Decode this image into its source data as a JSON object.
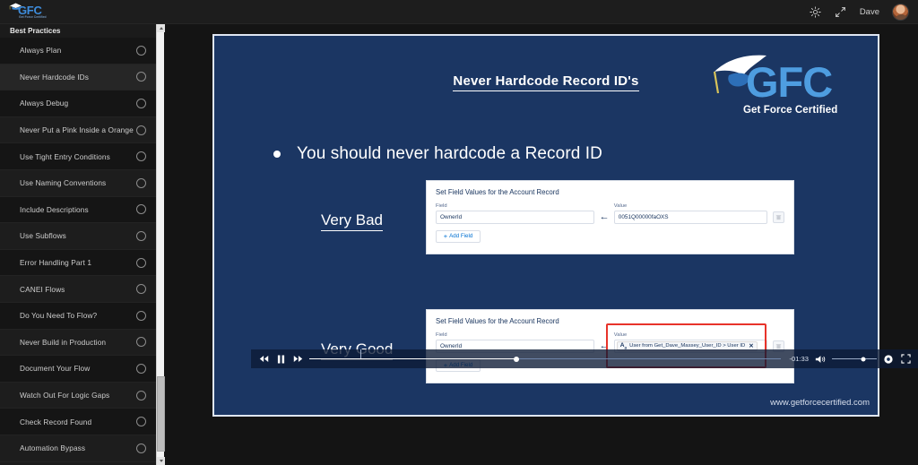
{
  "topbar": {
    "logo_main": "GFC",
    "logo_sub": "Get Force Certified",
    "theme_icon": "sun-icon",
    "expand_icon": "expand-arrows-icon",
    "user_name": "Dave",
    "avatar_icon": "user-avatar"
  },
  "sidebar": {
    "title": "Best Practices",
    "items": [
      {
        "label": "Always Plan",
        "completed": false
      },
      {
        "label": "Never Hardcode IDs",
        "completed": false,
        "active": true
      },
      {
        "label": "Always Debug",
        "completed": false
      },
      {
        "label": "Never Put a Pink Inside a Orange",
        "completed": false
      },
      {
        "label": "Use Tight Entry Conditions",
        "completed": false
      },
      {
        "label": "Use Naming Conventions",
        "completed": false
      },
      {
        "label": "Include Descriptions",
        "completed": false
      },
      {
        "label": "Use Subflows",
        "completed": false
      },
      {
        "label": "Error Handling Part 1",
        "completed": false
      },
      {
        "label": "CANEI Flows",
        "completed": false
      },
      {
        "label": "Do You Need To Flow?",
        "completed": false
      },
      {
        "label": "Never Build in Production",
        "completed": false
      },
      {
        "label": "Document Your Flow",
        "completed": false
      },
      {
        "label": "Watch Out For Logic Gaps",
        "completed": false
      },
      {
        "label": "Check Record Found",
        "completed": false
      },
      {
        "label": "Automation Bypass",
        "completed": false
      }
    ]
  },
  "slide": {
    "title": "Never Hardcode Record ID's",
    "logo_main": "GFC",
    "logo_sub": "Get Force Certified",
    "bullet": "You should never hardcode a Record ID",
    "bad_label": "Very Bad",
    "good_label": "Very Good",
    "watermark": "www.getforcecertified.com",
    "bad_card": {
      "heading": "Set Field Values for the Account Record",
      "field_label": "Field",
      "field_value": "OwnerId",
      "value_label": "Value",
      "value_value": "0051Q00000faOXS",
      "add_field_label": "Add Field",
      "arrow_icon": "arrow-left-icon",
      "delete_icon": "trash-icon"
    },
    "good_card": {
      "heading": "Set Field Values for the Account Record",
      "field_label": "Field",
      "field_value": "OwnerId",
      "value_label": "Value",
      "pill_icon": "merge-field-Aa-icon",
      "pill_text": "User from Get_Dave_Massey_User_ID > User ID",
      "pill_remove_icon": "remove-x-icon",
      "add_field_label": "Add Field",
      "arrow_icon": "arrow-left-icon",
      "delete_icon": "trash-icon",
      "highlight_color": "#e8332a"
    }
  },
  "player": {
    "rewind_icon": "rewind-icon",
    "pause_icon": "pause-icon",
    "forward_icon": "fast-forward-icon",
    "time_remaining": "-01:33",
    "volume_icon": "volume-icon",
    "settings_icon": "gear-icon",
    "fullscreen_icon": "fullscreen-icon",
    "progress_percent": 44,
    "volume_percent": 70
  },
  "colors": {
    "slide_bg": "#1b3663",
    "accent_blue": "#4e9de0",
    "sidebar_bg": "#1b1b1b",
    "highlight_red": "#e8332a"
  }
}
